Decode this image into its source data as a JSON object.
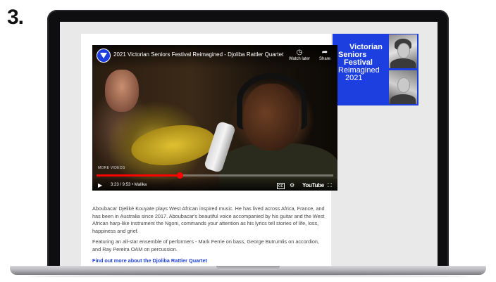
{
  "step": {
    "number": "3."
  },
  "banner": {
    "lines": [
      "Victorian",
      "Seniors",
      "Festival",
      "Reimagined",
      "2021"
    ],
    "color": "#1d3fe0"
  },
  "video": {
    "title": "2021 Victorian Seniors Festival Reimagined - Djoliba Rattler Quartet",
    "watch_later_label": "Watch later",
    "share_label": "Share",
    "more_videos_label": "MORE VIDEOS",
    "time_text": "3:23 / 9:53 • Malika",
    "progress": 0.35,
    "youtube_label": "YouTube",
    "icons": [
      "play-icon",
      "volume-icon",
      "captions-icon",
      "settings-icon",
      "fullscreen-icon",
      "clock-icon",
      "share-icon"
    ]
  },
  "article": {
    "paragraph1": "Aboubacar Djeliké Kouyate plays West African inspired music. He has lived across Africa, France, and has been in Australia since 2017. Aboubacar's beautiful voice accompanied by his guitar and the West African harp-like instrument the Ngoni, commands your attention as his lyrics tell stories of life, loss, happiness and grief.",
    "paragraph2": "Featuring an all-star ensemble of performers - Mark Ferrie on bass, George Butrumlis on accordion, and Ray Pereira OAM on percussion.",
    "link_text": "Find out more about the Djoliba Rattler Quartet"
  }
}
